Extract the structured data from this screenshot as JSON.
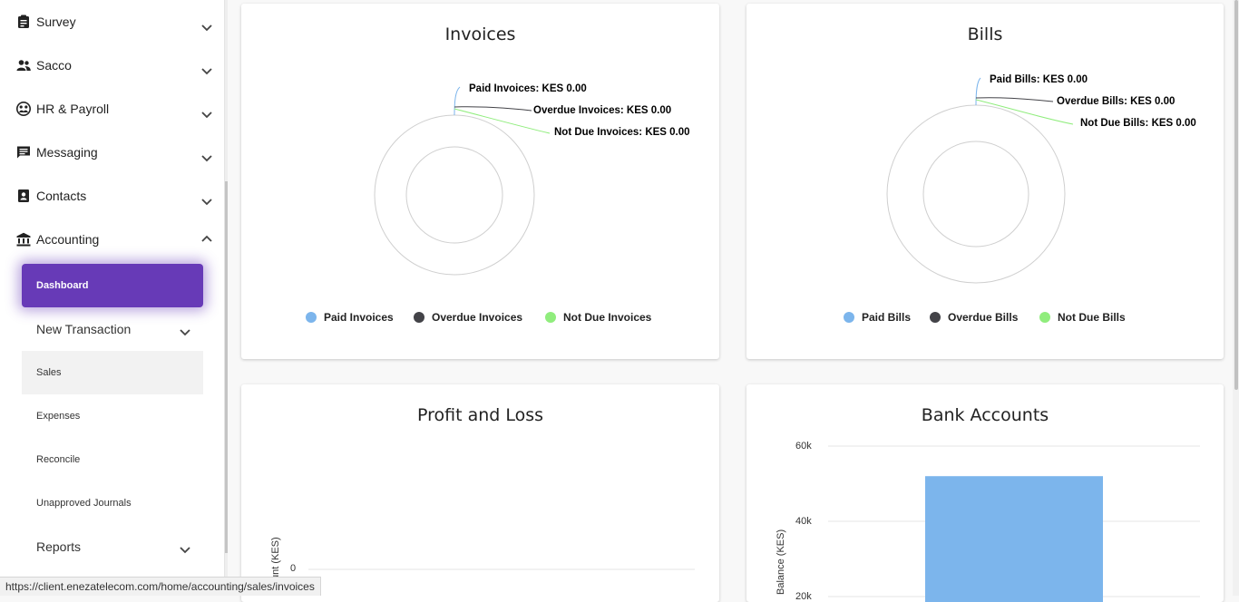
{
  "sidebar": {
    "items": [
      {
        "label": "Survey",
        "icon": "clipboard-icon",
        "expanded": false
      },
      {
        "label": "Sacco",
        "icon": "people-icon",
        "expanded": false
      },
      {
        "label": "HR & Payroll",
        "icon": "globe-person-icon",
        "expanded": false
      },
      {
        "label": "Messaging",
        "icon": "message-icon",
        "expanded": false
      },
      {
        "label": "Contacts",
        "icon": "contacts-icon",
        "expanded": false
      },
      {
        "label": "Accounting",
        "icon": "bank-icon",
        "expanded": true
      }
    ],
    "accounting_sub": [
      {
        "label": "Dashboard",
        "state": "active"
      },
      {
        "label": "New Transaction",
        "state": "collapsible"
      },
      {
        "label": "Sales",
        "state": "hover"
      },
      {
        "label": "Expenses",
        "state": "normal"
      },
      {
        "label": "Reconcile",
        "state": "normal"
      },
      {
        "label": "Unapproved Journals",
        "state": "normal"
      },
      {
        "label": "Reports",
        "state": "collapsible"
      }
    ],
    "accent_color": "#673ab7"
  },
  "cards": {
    "invoices": {
      "title": "Invoices",
      "callouts": [
        "Paid Invoices: KES 0.00",
        "Overdue Invoices: KES 0.00",
        "Not Due Invoices: KES 0.00"
      ],
      "legend": [
        {
          "label": "Paid Invoices",
          "color": "#7cb5ec"
        },
        {
          "label": "Overdue Invoices",
          "color": "#434348"
        },
        {
          "label": "Not Due Invoices",
          "color": "#90ed7d"
        }
      ]
    },
    "bills": {
      "title": "Bills",
      "callouts": [
        "Paid Bills: KES 0.00",
        "Overdue Bills: KES 0.00",
        "Not Due Bills: KES 0.00"
      ],
      "legend": [
        {
          "label": "Paid Bills",
          "color": "#7cb5ec"
        },
        {
          "label": "Overdue Bills",
          "color": "#434348"
        },
        {
          "label": "Not Due Bills",
          "color": "#90ed7d"
        }
      ]
    },
    "profit_loss": {
      "title": "Profit and Loss",
      "ytick": "0",
      "ylabel_visible": "unt (KES)"
    },
    "bank_accounts": {
      "title": "Bank Accounts",
      "yticks": [
        "60k",
        "40k",
        "20k"
      ],
      "ylabel_visible": "Balance (KES)",
      "bar_color": "#7cb5ec"
    }
  },
  "status_url": "https://client.enezatelecom.com/home/accounting/sales/invoices",
  "chart_data": [
    {
      "type": "pie",
      "title": "Invoices",
      "series": [
        {
          "name": "Paid Invoices",
          "value": 0
        },
        {
          "name": "Overdue Invoices",
          "value": 0
        },
        {
          "name": "Not Due Invoices",
          "value": 0
        }
      ]
    },
    {
      "type": "pie",
      "title": "Bills",
      "series": [
        {
          "name": "Paid Bills",
          "value": 0
        },
        {
          "name": "Overdue Bills",
          "value": 0
        },
        {
          "name": "Not Due Bills",
          "value": 0
        }
      ]
    },
    {
      "type": "bar",
      "title": "Profit and Loss",
      "categories": [],
      "values": [],
      "ylim": [
        0,
        0
      ]
    },
    {
      "type": "bar",
      "title": "Bank Accounts",
      "categories": [
        ""
      ],
      "values": [
        52000
      ],
      "ylim": [
        20000,
        60000
      ],
      "ylabel": "Balance (KES)"
    }
  ]
}
